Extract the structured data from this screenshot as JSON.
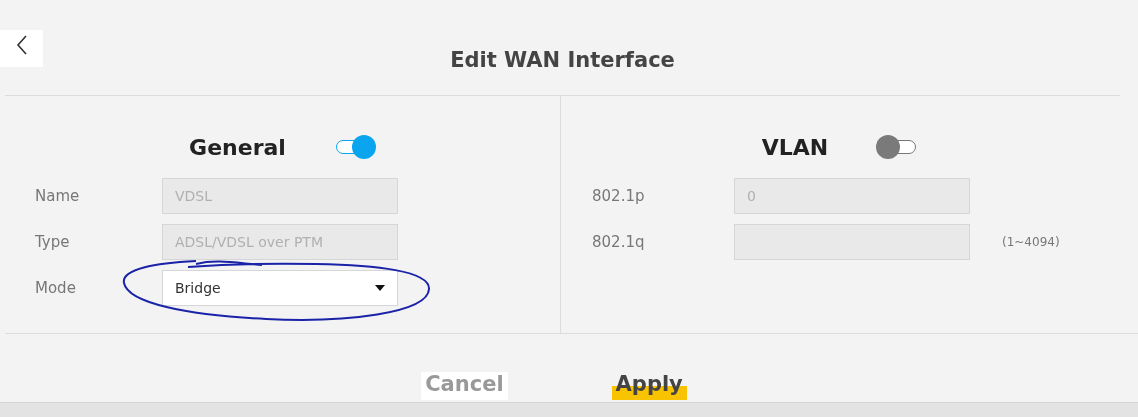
{
  "title": "Edit WAN Interface",
  "sections": [
    {
      "title": "General",
      "enabled": true,
      "fields": [
        {
          "label": "Name",
          "kind": "text",
          "value": "VDSL",
          "disabled": true
        },
        {
          "label": "Type",
          "kind": "text",
          "value": "ADSL/VDSL over PTM",
          "disabled": true
        },
        {
          "label": "Mode",
          "kind": "select",
          "value": "Bridge",
          "disabled": false
        }
      ]
    },
    {
      "title": "VLAN",
      "enabled": false,
      "fields": [
        {
          "label": "802.1p",
          "kind": "text",
          "value": "0",
          "disabled": true
        },
        {
          "label": "802.1q",
          "kind": "text",
          "disabled": true,
          "hint": "(1~4094)"
        }
      ]
    }
  ],
  "buttons": [
    {
      "label": "Cancel",
      "kind": "cancel"
    },
    {
      "label": "Apply",
      "kind": "primary"
    }
  ]
}
